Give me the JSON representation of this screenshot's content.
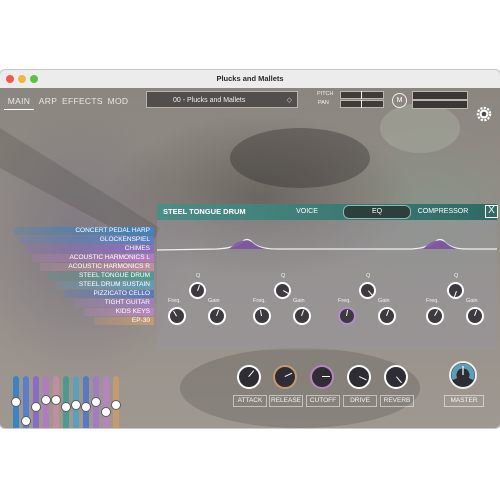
{
  "window": {
    "title": "Plucks and Mallets"
  },
  "tabs": [
    {
      "label": "MAIN",
      "active": true
    },
    {
      "label": "ARP",
      "active": false
    },
    {
      "label": "EFFECTS",
      "active": false
    },
    {
      "label": "MOD",
      "active": false
    }
  ],
  "preset": {
    "name": "00 - Plucks and Mallets"
  },
  "header": {
    "pitch_label": "PITCH",
    "pan_label": "PAN",
    "midi_button": "M"
  },
  "eq_panel": {
    "title": "STEEL TONGUE DRUM",
    "tabs": [
      {
        "label": "VOICE",
        "active": false
      },
      {
        "label": "EQ",
        "active": true
      },
      {
        "label": "COMPRESSOR",
        "active": false
      }
    ],
    "close_label": "X",
    "bands": [
      {
        "q_label": "Q",
        "freq_label": "Freq.",
        "gain_label": "Gain"
      },
      {
        "q_label": "Q",
        "freq_label": "Freq.",
        "gain_label": "Gain"
      },
      {
        "q_label": "Q",
        "freq_label": "Freq.",
        "gain_label": "Gain"
      },
      {
        "q_label": "Q",
        "freq_label": "Freq.",
        "gain_label": "Gain"
      }
    ]
  },
  "patches": [
    {
      "label": "CONCERT PEDAL HARP",
      "color": "#3b84c4"
    },
    {
      "label": "GLOCKENSPIEL",
      "color": "#5b7ec8"
    },
    {
      "label": "CHIMES",
      "color": "#8a6cc4"
    },
    {
      "label": "ACOUSTIC HARMONICS L",
      "color": "#b27ac2"
    },
    {
      "label": "ACOUSTIC HARMONICS R",
      "color": "#c08ea0"
    },
    {
      "label": "STEEL TONGUE DRUM",
      "color": "#4f9a90"
    },
    {
      "label": "STEEL DRUM SUSTAIN",
      "color": "#5aa0b8"
    },
    {
      "label": "PIZZICATO CELLO",
      "color": "#5b78c2"
    },
    {
      "label": "TIGHT GUITAR",
      "color": "#a27cc0"
    },
    {
      "label": "KIDS KEYS",
      "color": "#b784c0"
    },
    {
      "label": "EP-30",
      "color": "#c49a70"
    }
  ],
  "faders": {
    "colors": [
      "#3b84c4",
      "#5b7ec8",
      "#8a6cc4",
      "#b27ac2",
      "#c08ea0",
      "#4f9a90",
      "#5aa0b8",
      "#5b78c2",
      "#a27cc0",
      "#b784c0",
      "#c49a70"
    ],
    "levels": [
      0.55,
      0.15,
      0.45,
      0.6,
      0.6,
      0.45,
      0.5,
      0.45,
      0.55,
      0.35,
      0.5
    ]
  },
  "controls": [
    {
      "label": "ATTACK"
    },
    {
      "label": "RELEASE"
    },
    {
      "label": "CUTOFF"
    },
    {
      "label": "DRIVE"
    },
    {
      "label": "REVERB"
    }
  ],
  "master": {
    "label": "MASTER"
  }
}
